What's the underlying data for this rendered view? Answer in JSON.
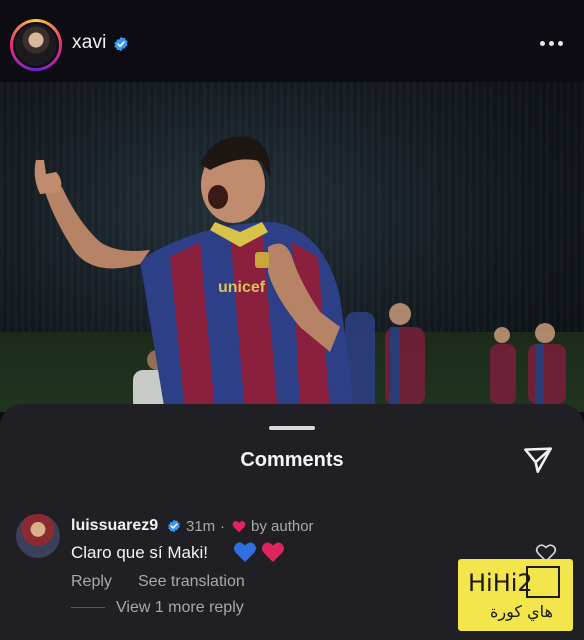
{
  "header": {
    "username": "xavi",
    "verified_icon": "verified-badge-icon",
    "more_icon": "more-options-icon"
  },
  "post": {
    "image": "post-photo"
  },
  "comments_sheet": {
    "title": "Comments",
    "share_icon": "send-icon",
    "comment": {
      "username": "luissuarez9",
      "time": "31m",
      "separator": "·",
      "liked_by_author": "by author",
      "text": "Claro que sí Maki!",
      "reply_label": "Reply",
      "translate_label": "See translation",
      "view_replies": "View 1 more reply"
    }
  },
  "watermark": {
    "latin": "HiHi2",
    "arabic": "هاي كورة"
  },
  "colors": {
    "sheet_bg": "#1f1f24",
    "verified_blue": "#3897f0",
    "heart_red": "#e0245e",
    "heart_blue": "#2f6fe0",
    "watermark_yellow": "#f2e64c"
  }
}
